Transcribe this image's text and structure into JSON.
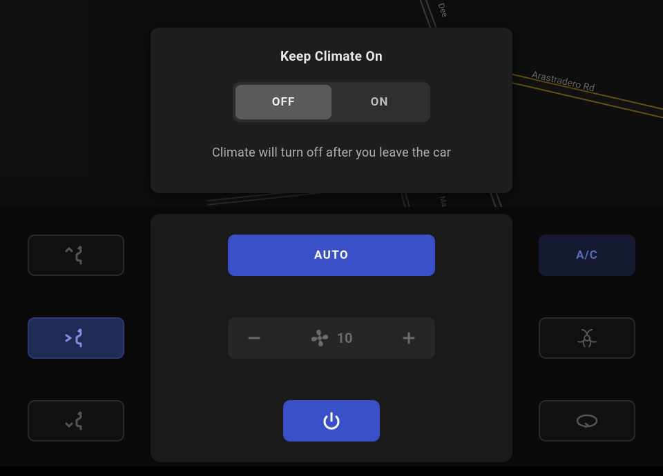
{
  "map": {
    "road1": "Arastradero Rd",
    "road2": "Dee",
    "road3": "Ma"
  },
  "modal": {
    "title": "Keep Climate On",
    "off_label": "OFF",
    "on_label": "ON",
    "selected": "OFF",
    "description": "Climate will turn off after you leave the car"
  },
  "climate": {
    "auto_label": "AUTO",
    "fan_speed": "10",
    "ac_label": "A/C"
  },
  "icons": {
    "vent_face_feet": "vent-face-feet",
    "vent_face": "vent-face",
    "vent_feet": "vent-feet",
    "biohazard": "biohazard",
    "recirculate": "recirculate",
    "power": "power",
    "fan": "fan",
    "minus": "minus",
    "plus": "plus"
  },
  "colors": {
    "accent": "#3a50c9",
    "panel": "#1a1a1a",
    "modal": "#1e1e1e"
  }
}
